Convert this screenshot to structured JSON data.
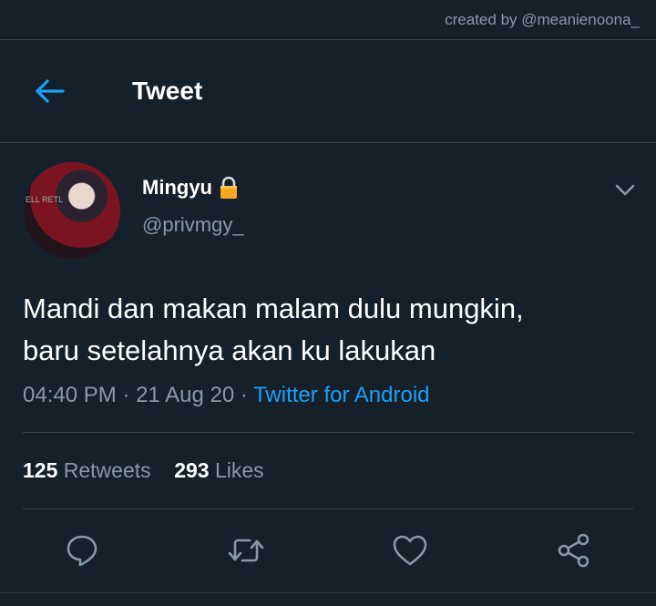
{
  "watermark": "created by @meanienoona_",
  "header": {
    "title": "Tweet"
  },
  "tweet": {
    "display_name": "Mingyu",
    "handle": "@privmgy_",
    "text_line1": "Mandi dan makan malam dulu mungkin,",
    "text_line2": "baru setelahnya akan ku lakukan",
    "time": "04:40 PM",
    "date": "21 Aug 20",
    "sep": "·",
    "source": "Twitter for Android",
    "avatar_text": "ELL RETL"
  },
  "stats": {
    "retweets_count": "125",
    "retweets_label": "Retweets",
    "likes_count": "293",
    "likes_label": "Likes"
  },
  "icons": [
    "back-arrow-icon",
    "lock-icon",
    "chevron-down-icon",
    "reply-icon",
    "retweet-icon",
    "like-icon",
    "share-icon"
  ],
  "colors": {
    "background": "#15202b",
    "accent": "#1da1f2",
    "muted": "#8899a6",
    "divider": "#38444d",
    "lock": "#f5a623"
  }
}
